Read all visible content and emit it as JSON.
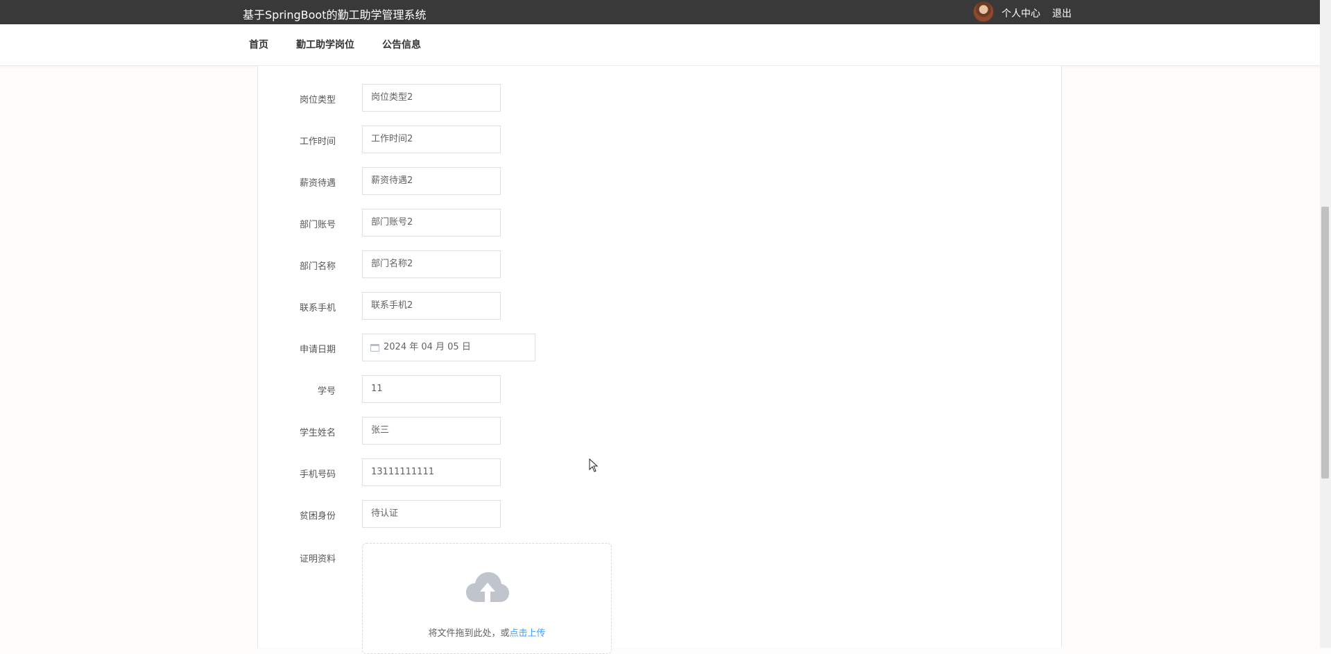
{
  "header": {
    "site_title": "基于SpringBoot的勤工助学管理系统",
    "user_center": "个人中心",
    "logout": "退出"
  },
  "nav": {
    "home": "首页",
    "jobs": "勤工助学岗位",
    "notices": "公告信息"
  },
  "form": {
    "fields": [
      {
        "label": "岗位类型",
        "value": "岗位类型2"
      },
      {
        "label": "工作时间",
        "value": "工作时间2"
      },
      {
        "label": "薪资待遇",
        "value": "薪资待遇2"
      },
      {
        "label": "部门账号",
        "value": "部门账号2"
      },
      {
        "label": "部门名称",
        "value": "部门名称2"
      },
      {
        "label": "联系手机",
        "value": "联系手机2"
      },
      {
        "label": "申请日期",
        "value": "2024 年 04 月 05 日"
      },
      {
        "label": "学号",
        "value": "11"
      },
      {
        "label": "学生姓名",
        "value": "张三"
      },
      {
        "label": "手机号码",
        "value": "13111111111"
      },
      {
        "label": "贫困身份",
        "value": "待认证"
      }
    ],
    "upload": {
      "label": "证明资料",
      "text": "将文件拖到此处，或",
      "link": "点击上传"
    }
  },
  "colors": {
    "topbar": "#393939",
    "link_blue": "#409eff",
    "upload_icon": "#c0c4cc"
  },
  "icons": {
    "calendar": "calendar-icon",
    "upload": "upload-cloud-icon",
    "avatar": "user-avatar"
  }
}
